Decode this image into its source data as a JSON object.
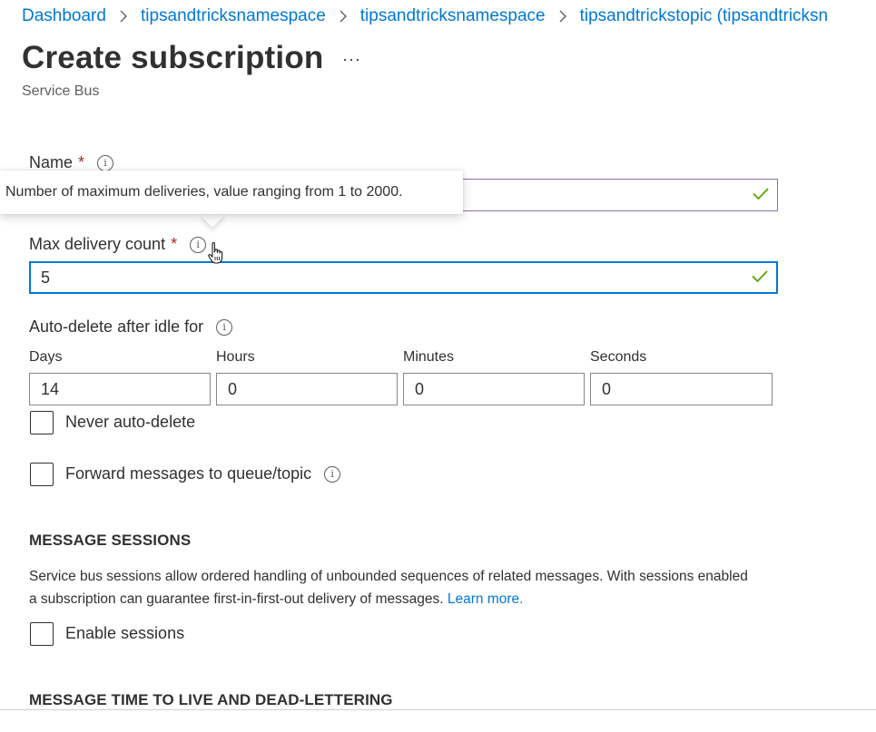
{
  "breadcrumb": {
    "items": [
      "Dashboard",
      "tipsandtricksnamespace",
      "tipsandtricksnamespace",
      "tipsandtrickstopic (tipsandtricksn"
    ]
  },
  "header": {
    "title": "Create subscription",
    "more_label": "···",
    "subtitle": "Service Bus"
  },
  "form": {
    "name": {
      "label": "Name",
      "required_mark": "*",
      "value": ""
    },
    "tooltip": {
      "text": "Number of maximum deliveries, value ranging from 1 to 2000."
    },
    "max_delivery": {
      "label": "Max delivery count",
      "required_mark": "*",
      "value": "5"
    },
    "auto_delete": {
      "label": "Auto-delete after idle for",
      "days": {
        "label": "Days",
        "value": "14"
      },
      "hours": {
        "label": "Hours",
        "value": "0"
      },
      "minutes": {
        "label": "Minutes",
        "value": "0"
      },
      "seconds": {
        "label": "Seconds",
        "value": "0"
      },
      "never_label": "Never auto-delete",
      "never_checked": false
    },
    "forward": {
      "label": "Forward messages to queue/topic",
      "checked": false
    }
  },
  "sessions": {
    "heading": "MESSAGE SESSIONS",
    "description": "Service bus sessions allow ordered handling of unbounded sequences of related messages. With sessions enabled a subscription can guarantee first-in-first-out delivery of messages.",
    "learn_more": "Learn more.",
    "enable_label": "Enable sessions",
    "enabled": false
  },
  "ttl": {
    "heading": "MESSAGE TIME TO LIVE AND DEAD-LETTERING"
  },
  "colors": {
    "link": "#0078d4",
    "focus_border": "#0078d4",
    "valid_check": "#57a300",
    "required": "#a4262c"
  }
}
